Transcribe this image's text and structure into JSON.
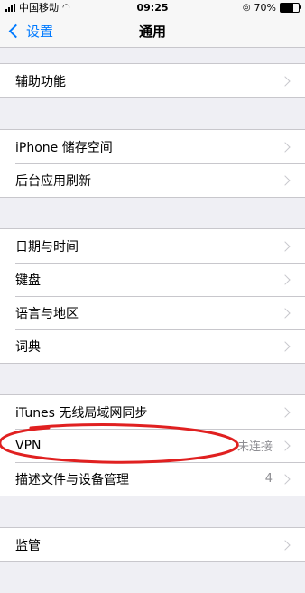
{
  "status": {
    "carrier": "中国移动",
    "time": "09:25",
    "battery": "70%",
    "battery_level": 0.7
  },
  "nav": {
    "back_label": "设置",
    "title": "通用"
  },
  "groups": [
    [
      {
        "label": "辅助功能"
      }
    ],
    [
      {
        "label": "iPhone 储存空间"
      },
      {
        "label": "后台应用刷新"
      }
    ],
    [
      {
        "label": "日期与时间"
      },
      {
        "label": "键盘"
      },
      {
        "label": "语言与地区"
      },
      {
        "label": "词典"
      }
    ],
    [
      {
        "label": "iTunes 无线局域网同步"
      },
      {
        "label": "VPN",
        "detail": "未连接"
      },
      {
        "label": "描述文件与设备管理",
        "detail": "4"
      }
    ],
    [
      {
        "label": "监管"
      }
    ]
  ],
  "annotation_color": "#e02020"
}
